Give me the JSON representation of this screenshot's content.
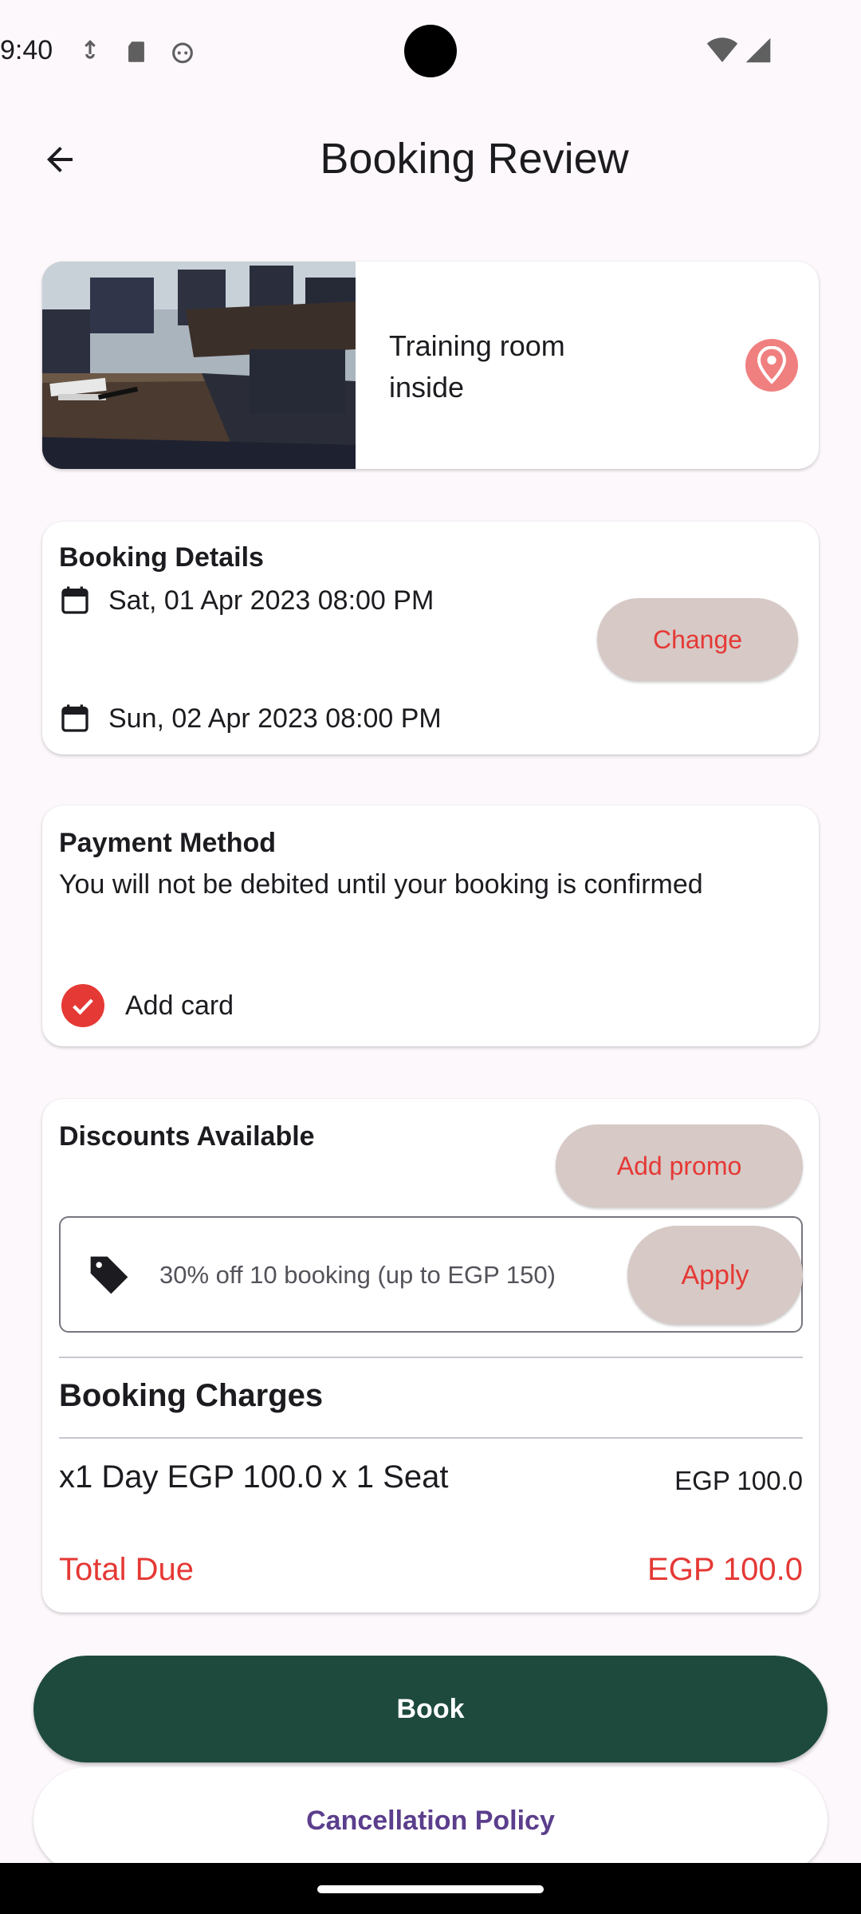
{
  "status_bar": {
    "time": "9:40"
  },
  "header": {
    "title": "Booking Review",
    "back_icon": "arrow-back-icon"
  },
  "room": {
    "name": "Training room inside",
    "location_icon": "location-pin-icon"
  },
  "booking_details": {
    "title": "Booking Details",
    "start": "Sat, 01 Apr 2023 08:00 PM",
    "end": "Sun, 02 Apr 2023 08:00 PM",
    "change_label": "Change"
  },
  "payment": {
    "title": "Payment Method",
    "note": "You will not be debited until your booking is confirmed",
    "add_card_label": "Add card"
  },
  "discounts": {
    "title": "Discounts Available",
    "add_promo_label": "Add promo",
    "offer_text": "30% off  10 booking (up to EGP 150)",
    "apply_label": "Apply"
  },
  "charges": {
    "title": "Booking Charges",
    "line_label": "x1 Day EGP 100.0 x 1 Seat",
    "line_amount": "EGP 100.0",
    "total_label": "Total Due",
    "total_amount": "EGP 100.0"
  },
  "actions": {
    "book_label": "Book",
    "cancellation_label": "Cancellation Policy"
  },
  "colors": {
    "accent": "#e53935",
    "primary": "#1e4a3e",
    "tonal_button": "#d6c9c6",
    "link": "#5b3e8c",
    "background": "#fcf8fc"
  }
}
